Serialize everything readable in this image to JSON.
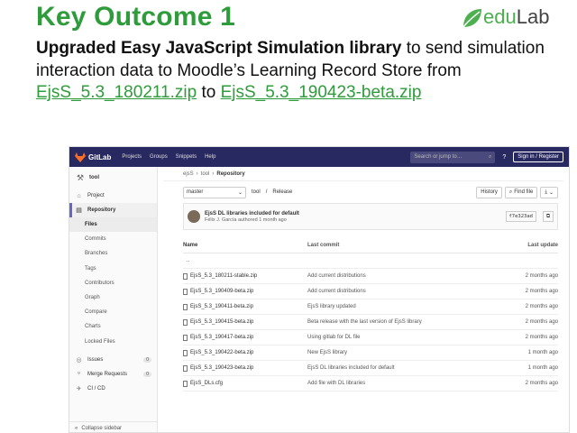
{
  "slide": {
    "title": "Key Outcome 1",
    "logo_text_e": "e",
    "logo_text_du": "du",
    "logo_text_lab": "Lab",
    "body_bold": "Upgraded Easy JavaScript Simulation library",
    "body_1": " to send simulation interaction data to Moodle’s Learning Record Store from ",
    "link_from": "EjsS_5.3_180211.zip",
    "body_2": " to ",
    "link_to": "EjsS_5.3_190423-beta.zip"
  },
  "gitlab": {
    "logo": "GitLab",
    "nav": [
      "Projects",
      "Groups",
      "Snippets",
      "Help"
    ],
    "search_placeholder": "Search or jump to…",
    "help_icon": "?",
    "sign_in": "Sign in / Register",
    "project_name": "tool",
    "sidebar": {
      "project": "Project",
      "repository": "Repository",
      "sub": [
        "Files",
        "Commits",
        "Branches",
        "Tags",
        "Contributors",
        "Graph",
        "Compare",
        "Charts",
        "Locked Files"
      ],
      "issues": "Issues",
      "issues_count": "0",
      "merge_requests": "Merge Requests",
      "mr_count": "0",
      "cicd": "CI / CD",
      "collapse": "Collapse sidebar"
    },
    "breadcrumb": [
      "ejsS",
      "tool",
      "Repository"
    ],
    "branch": "master",
    "path": [
      "tool",
      "Release"
    ],
    "history": "History",
    "find_file": "Find file",
    "commit": {
      "title": "EjsS DL libraries included for default",
      "author": "Félix J. García authored 1 month ago",
      "sha": "f7e323ad"
    },
    "table_headers": {
      "name": "Name",
      "last_commit": "Last commit",
      "last_update": "Last update"
    },
    "parent_dir": "..",
    "files": [
      {
        "name": "EjsS_5.3_180211-stable.zip",
        "msg": "Add current distributions",
        "date": "2 months ago"
      },
      {
        "name": "EjsS_5.3_190409-beta.zip",
        "msg": "Add current distributions",
        "date": "2 months ago"
      },
      {
        "name": "EjsS_5.3_190411-beta.zip",
        "msg": "EjsS library updated",
        "date": "2 months ago"
      },
      {
        "name": "EjsS_5.3_190415-beta.zip",
        "msg": "Beta release with the last version of EjsS library",
        "date": "2 months ago"
      },
      {
        "name": "EjsS_5.3_190417-beta.zip",
        "msg": "Using gitlab for DL file",
        "date": "2 months ago"
      },
      {
        "name": "EjsS_5.3_190422-beta.zip",
        "msg": "New EjsS library",
        "date": "1 month ago"
      },
      {
        "name": "EjsS_5.3_190423-beta.zip",
        "msg": "EjsS DL libraries included for default",
        "date": "1 month ago"
      },
      {
        "name": "EjsS_DLs.cfg",
        "msg": "Add file with DL libraries",
        "date": "2 months ago"
      }
    ]
  },
  "colors": {
    "title_green": "#2e9c3a",
    "gitlab_header": "#292961"
  }
}
